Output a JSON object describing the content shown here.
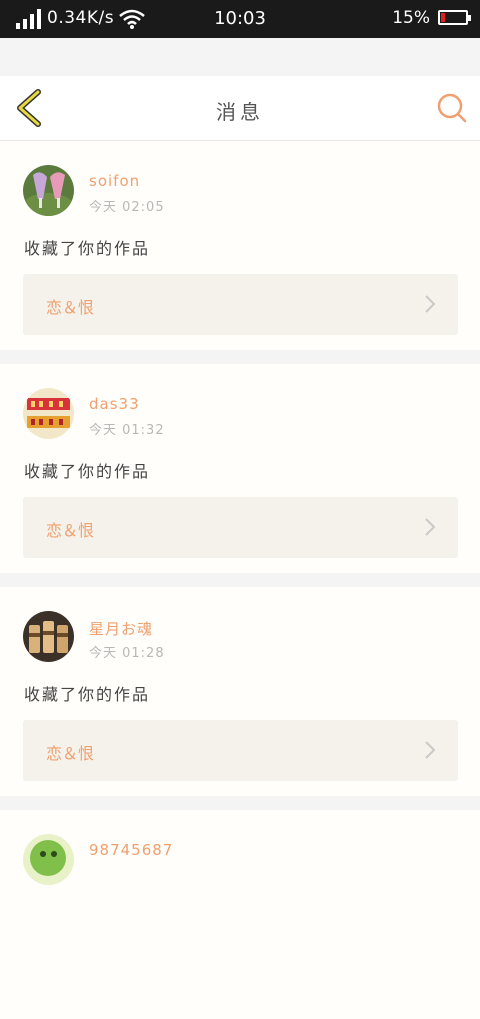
{
  "status_bar": {
    "net_speed": "0.34K/s",
    "time": "10:03",
    "battery": "15%",
    "battery_level": 0.15
  },
  "header": {
    "title": "消息",
    "back_icon": "chevron-left-icon",
    "search_icon": "search-icon"
  },
  "colors": {
    "accent": "#f0a070",
    "back_icon": "#e8d840"
  },
  "messages": [
    {
      "username": "soifon",
      "time": "今天 02:05",
      "action": "收藏了你的作品",
      "work_title": "恋＆恨",
      "avatar": "purple-glasses-photo"
    },
    {
      "username": "das33",
      "time": "今天 01:32",
      "action": "收藏了你的作品",
      "work_title": "恋＆恨",
      "avatar": "red-characters-photo"
    },
    {
      "username": "星月お魂",
      "time": "今天 01:28",
      "action": "收藏了你的作品",
      "work_title": "恋＆恨",
      "avatar": "wooden-cups-photo"
    },
    {
      "username": "98745687",
      "avatar": "green-cartoon-photo"
    }
  ]
}
